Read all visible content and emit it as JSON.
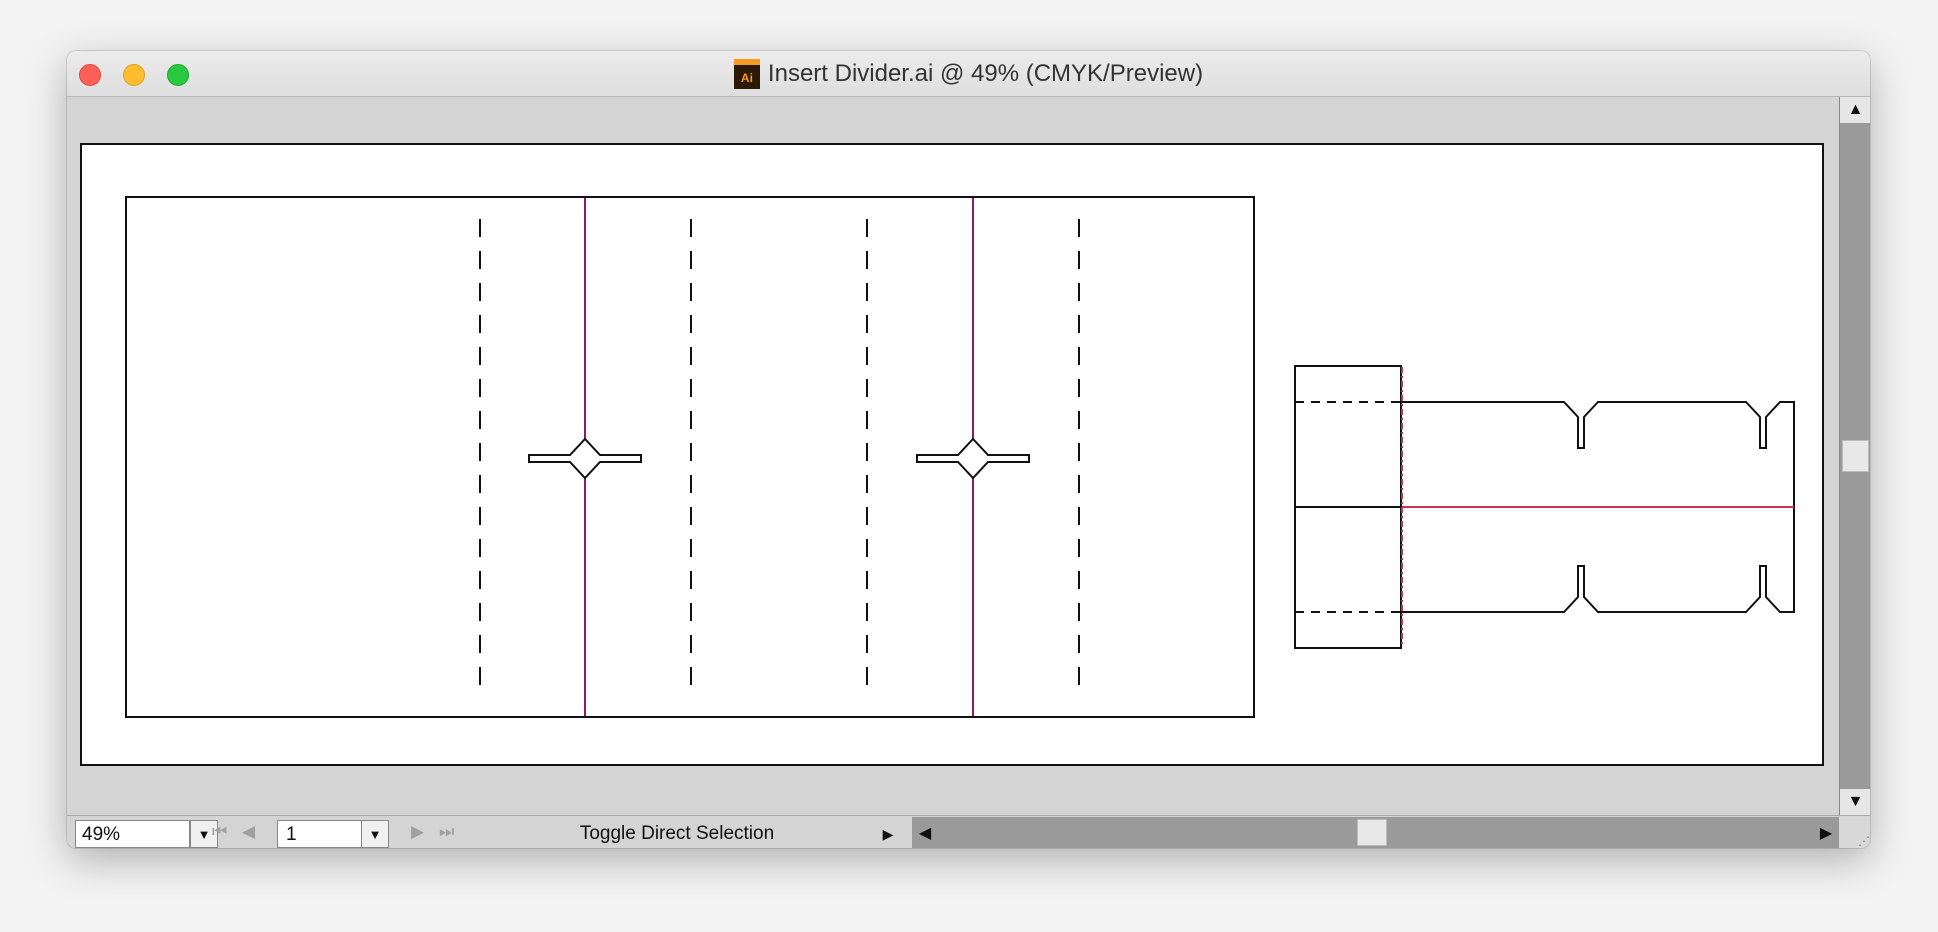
{
  "window": {
    "title": "Insert Divider.ai @ 49% (CMYK/Preview)",
    "icon_label": "Ai",
    "icon_name": "illustrator-doc-icon"
  },
  "colors": {
    "fold_line": "#8e1a6a",
    "crease_red": "#c8334e",
    "cut_line": "#111111",
    "close": "#fe5f57",
    "minimize": "#febc2e",
    "zoom": "#28c840"
  },
  "statusbar": {
    "zoom_value": "49%",
    "page_value": "1",
    "status_text": "Toggle Direct Selection",
    "icons": {
      "dropdown": "chevron-down-icon",
      "first": "first-page-icon",
      "prev": "prev-page-icon",
      "next": "next-page-icon",
      "last": "last-page-icon",
      "menu": "triangle-right-icon"
    }
  },
  "scrollbars": {
    "vertical_position": 0.5,
    "horizontal_position": 0.5
  }
}
